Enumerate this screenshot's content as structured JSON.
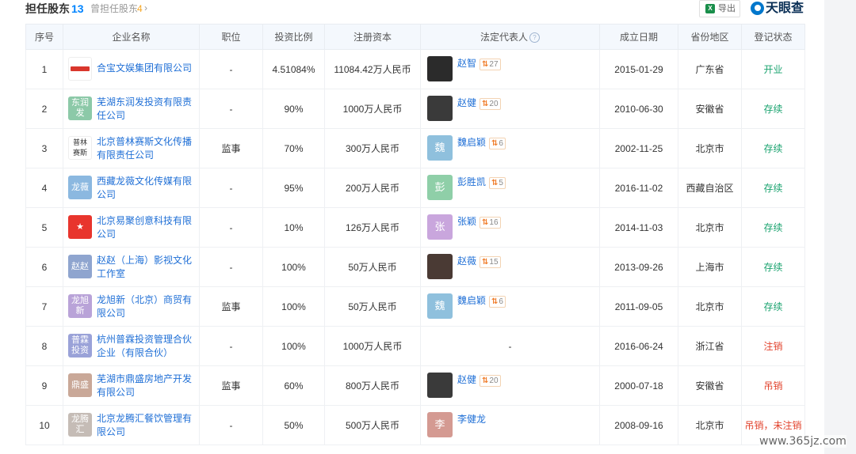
{
  "header": {
    "title": "担任股东",
    "count": "13",
    "former_label": "曾担任股东",
    "former_count": "4",
    "export_label": "导出",
    "brand": "天眼查"
  },
  "columns": [
    "序号",
    "企业名称",
    "职位",
    "投资比例",
    "注册资本",
    "法定代表人",
    "成立日期",
    "省份地区",
    "登记状态"
  ],
  "rows": [
    {
      "no": "1",
      "company": "合宝文娱集团有限公司",
      "logo_text": "",
      "logo_color": "#ffffff",
      "position": "-",
      "ratio": "4.51084%",
      "capital": "11084.42万人民币",
      "rep": "赵智",
      "rep_avatar": "",
      "rep_avatar_color": "#2b2b2b",
      "rep_count": "27",
      "date": "2015-01-29",
      "region": "广东省",
      "status": "开业",
      "status_type": "green"
    },
    {
      "no": "2",
      "company": "芜湖东润发投资有限责任公司",
      "logo_text": "东润发",
      "logo_color": "#8cc9a8",
      "position": "-",
      "ratio": "90%",
      "capital": "1000万人民币",
      "rep": "赵健",
      "rep_avatar": "",
      "rep_avatar_color": "#3a3a3a",
      "rep_count": "20",
      "date": "2010-06-30",
      "region": "安徽省",
      "status": "存续",
      "status_type": "green"
    },
    {
      "no": "3",
      "company": "北京普林赛斯文化传播有限责任公司",
      "logo_text": "普林赛斯",
      "logo_color": "#ffffff",
      "position": "监事",
      "ratio": "70%",
      "capital": "300万人民币",
      "rep": "魏启颖",
      "rep_avatar": "魏",
      "rep_avatar_color": "#8fc0dd",
      "rep_count": "6",
      "date": "2002-11-25",
      "region": "北京市",
      "status": "存续",
      "status_type": "green"
    },
    {
      "no": "4",
      "company": "西藏龙薇文化传媒有限公司",
      "logo_text": "龙薇",
      "logo_color": "#8bb8e0",
      "position": "-",
      "ratio": "95%",
      "capital": "200万人民币",
      "rep": "彭胜凯",
      "rep_avatar": "彭",
      "rep_avatar_color": "#8fcfa8",
      "rep_count": "5",
      "date": "2016-11-02",
      "region": "西藏自治区",
      "status": "存续",
      "status_type": "green"
    },
    {
      "no": "5",
      "company": "北京易聚创意科技有限公司",
      "logo_text": "★",
      "logo_color": "#e8352d",
      "position": "-",
      "ratio": "10%",
      "capital": "126万人民币",
      "rep": "张颖",
      "rep_avatar": "张",
      "rep_avatar_color": "#c9a6dd",
      "rep_count": "16",
      "date": "2014-11-03",
      "region": "北京市",
      "status": "存续",
      "status_type": "green"
    },
    {
      "no": "6",
      "company": "赵赵（上海）影视文化工作室",
      "logo_text": "赵赵",
      "logo_color": "#8fa5cf",
      "position": "-",
      "ratio": "100%",
      "capital": "50万人民币",
      "rep": "赵薇",
      "rep_avatar": "",
      "rep_avatar_color": "#4a3a34",
      "rep_count": "15",
      "date": "2013-09-26",
      "region": "上海市",
      "status": "存续",
      "status_type": "green"
    },
    {
      "no": "7",
      "company": "龙旭新（北京）商贸有限公司",
      "logo_text": "龙旭新",
      "logo_color": "#b9a3d8",
      "position": "监事",
      "ratio": "100%",
      "capital": "50万人民币",
      "rep": "魏启颖",
      "rep_avatar": "魏",
      "rep_avatar_color": "#8fc0dd",
      "rep_count": "6",
      "date": "2011-09-05",
      "region": "北京市",
      "status": "存续",
      "status_type": "green"
    },
    {
      "no": "8",
      "company": "杭州普霖投资管理合伙企业（有限合伙）",
      "logo_text": "普霖投资",
      "logo_color": "#9aa2d8",
      "position": "-",
      "ratio": "100%",
      "capital": "1000万人民币",
      "rep": "-",
      "rep_avatar": "",
      "rep_avatar_color": "",
      "rep_count": "",
      "date": "2016-06-24",
      "region": "浙江省",
      "status": "注销",
      "status_type": "red"
    },
    {
      "no": "9",
      "company": "芜湖市鼎盛房地产开发有限公司",
      "logo_text": "鼎盛",
      "logo_color": "#c9a898",
      "position": "监事",
      "ratio": "60%",
      "capital": "800万人民币",
      "rep": "赵健",
      "rep_avatar": "",
      "rep_avatar_color": "#3a3a3a",
      "rep_count": "20",
      "date": "2000-07-18",
      "region": "安徽省",
      "status": "吊销",
      "status_type": "red"
    },
    {
      "no": "10",
      "company": "北京龙腾汇餐饮管理有限公司",
      "logo_text": "龙腾汇",
      "logo_color": "#c5bcb6",
      "position": "-",
      "ratio": "50%",
      "capital": "500万人民币",
      "rep": "李健龙",
      "rep_avatar": "李",
      "rep_avatar_color": "#d49a92",
      "rep_count": "",
      "date": "2008-09-16",
      "region": "北京市",
      "status": "吊销，未注销",
      "status_type": "red"
    }
  ],
  "watermark": "www.365jz.com"
}
